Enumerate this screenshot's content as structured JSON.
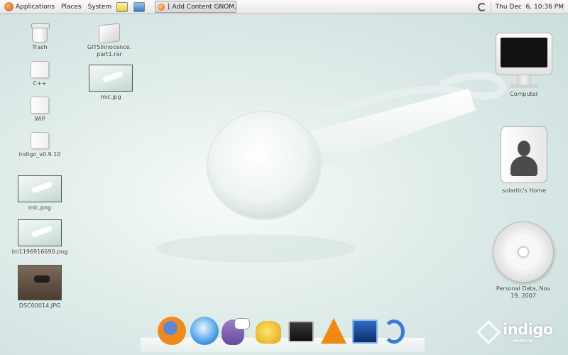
{
  "top_panel": {
    "menus": [
      "Applications",
      "Places",
      "System"
    ],
    "launchers": [
      "notes-icon",
      "mail-icon"
    ],
    "taskbar_window": "[ Add Content GNOM...",
    "clock": "Thu Dec  6, 10:36 PM"
  },
  "desktop_left": [
    {
      "label": "Trash",
      "icon": "trash-icon"
    },
    {
      "label": "C++",
      "icon": "folder-icon"
    },
    {
      "label": "WIP",
      "icon": "folder-icon"
    },
    {
      "label": "indigo_v0.9.10",
      "icon": "folder-icon"
    },
    {
      "label": "mic.png",
      "icon": "image-thumbnail"
    },
    {
      "label": "im1196916690.png",
      "icon": "image-thumbnail"
    },
    {
      "label": "DSC00014.JPG",
      "icon": "photo-thumbnail"
    }
  ],
  "desktop_second_column": [
    {
      "label": "GITSInnocence.\npart1.rar",
      "icon": "archive-icon"
    },
    {
      "label": "mic.jpg",
      "icon": "image-thumbnail"
    }
  ],
  "desktop_right": [
    {
      "label": "Computer",
      "icon": "computer-icon"
    },
    {
      "label": "solartic's Home",
      "icon": "home-folder-icon"
    },
    {
      "label": "Personal Data, Nov\n19, 2007",
      "icon": "cd-icon"
    }
  ],
  "dock": {
    "items": [
      "firefox-icon",
      "mirror-icon",
      "pidgin-icon",
      "teapot-icon",
      "terminal-icon",
      "vlc-icon",
      "system-monitor-icon",
      "beryl-icon"
    ]
  },
  "branding": {
    "name": "indigo",
    "sub": "renderer"
  }
}
